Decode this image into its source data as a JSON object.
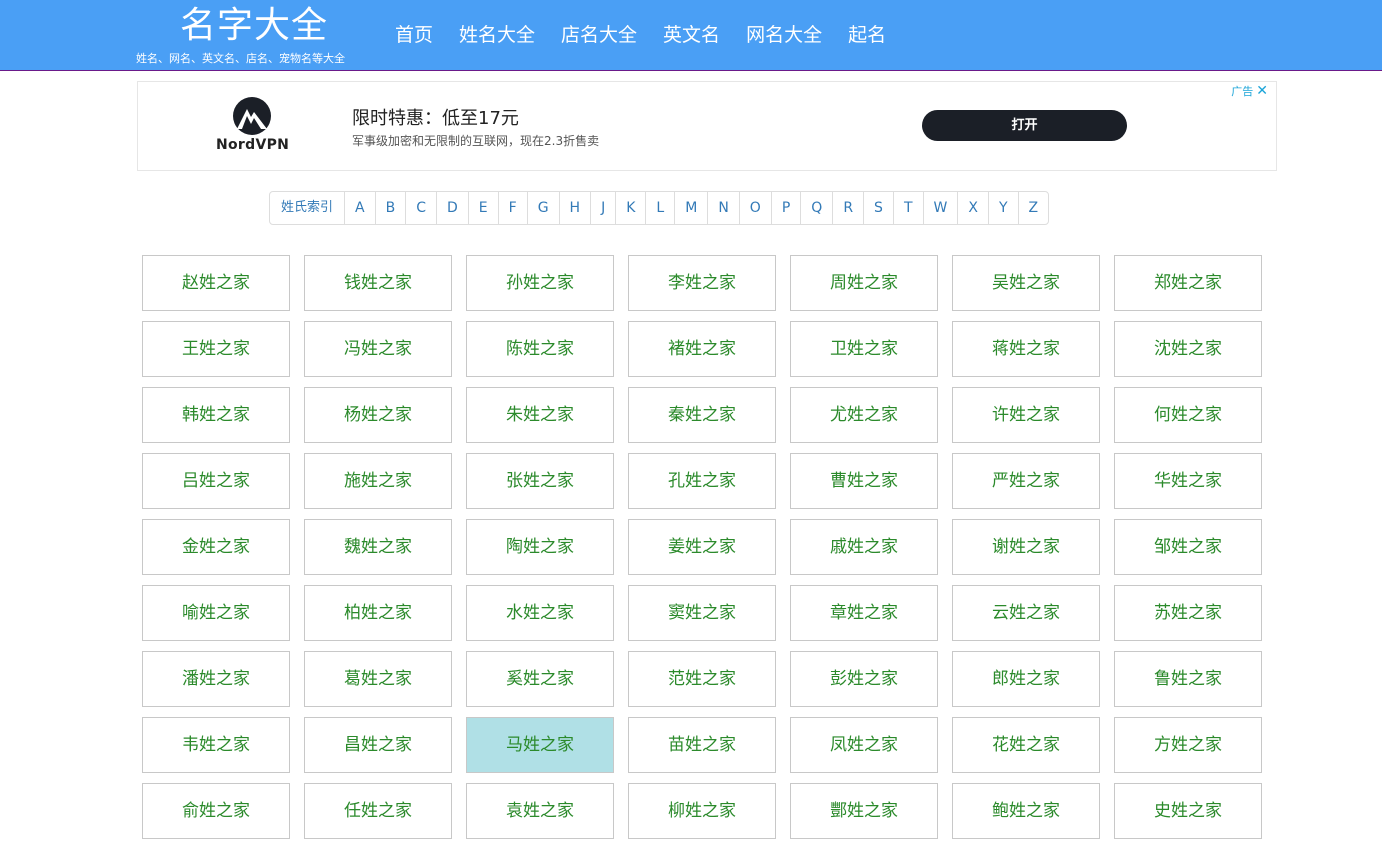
{
  "header": {
    "logo": "名字大全",
    "slogan": "姓名、网名、英文名、店名、宠物名等大全",
    "nav": [
      "首页",
      "姓名大全",
      "店名大全",
      "英文名",
      "网名大全",
      "起名"
    ]
  },
  "ad": {
    "brand": "NordVPN",
    "title": "限时特惠：低至17元",
    "desc": "军事级加密和无限制的互联网，现在2.3折售卖",
    "button": "打开",
    "tag": "广告",
    "close": "✕"
  },
  "index": {
    "label": "姓氏索引",
    "letters": [
      "A",
      "B",
      "C",
      "D",
      "E",
      "F",
      "G",
      "H",
      "J",
      "K",
      "L",
      "M",
      "N",
      "O",
      "P",
      "Q",
      "R",
      "S",
      "T",
      "W",
      "X",
      "Y",
      "Z"
    ]
  },
  "surnames": [
    "赵姓之家",
    "钱姓之家",
    "孙姓之家",
    "李姓之家",
    "周姓之家",
    "吴姓之家",
    "郑姓之家",
    "王姓之家",
    "冯姓之家",
    "陈姓之家",
    "褚姓之家",
    "卫姓之家",
    "蒋姓之家",
    "沈姓之家",
    "韩姓之家",
    "杨姓之家",
    "朱姓之家",
    "秦姓之家",
    "尤姓之家",
    "许姓之家",
    "何姓之家",
    "吕姓之家",
    "施姓之家",
    "张姓之家",
    "孔姓之家",
    "曹姓之家",
    "严姓之家",
    "华姓之家",
    "金姓之家",
    "魏姓之家",
    "陶姓之家",
    "姜姓之家",
    "戚姓之家",
    "谢姓之家",
    "邹姓之家",
    "喻姓之家",
    "柏姓之家",
    "水姓之家",
    "窦姓之家",
    "章姓之家",
    "云姓之家",
    "苏姓之家",
    "潘姓之家",
    "葛姓之家",
    "奚姓之家",
    "范姓之家",
    "彭姓之家",
    "郎姓之家",
    "鲁姓之家",
    "韦姓之家",
    "昌姓之家",
    "马姓之家",
    "苗姓之家",
    "凤姓之家",
    "花姓之家",
    "方姓之家",
    "俞姓之家",
    "任姓之家",
    "袁姓之家",
    "柳姓之家",
    "酆姓之家",
    "鲍姓之家",
    "史姓之家"
  ],
  "active_surname": "马姓之家",
  "colors": {
    "header_bg": "#4a9ff5",
    "tile_text": "#2b8a2b",
    "tile_active_bg": "#b0e0e6"
  }
}
